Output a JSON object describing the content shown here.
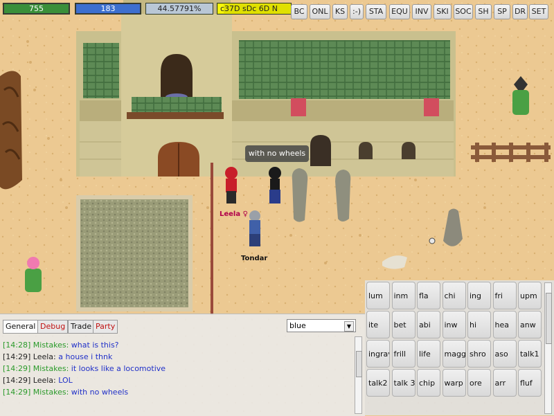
{
  "status": {
    "hp": {
      "value": "755",
      "fraction": 1.0
    },
    "mp": {
      "value": "183",
      "fraction": 1.0
    },
    "xp": {
      "value": "44.57791%",
      "fraction": 0.4458
    },
    "money": {
      "value": "c37D sDc 6D N",
      "fraction": 0.08
    }
  },
  "top_buttons": [
    "BC",
    "ONL",
    "KS",
    ":-)",
    "STA",
    "EQU",
    "INV",
    "SKI",
    "SOC",
    "SH",
    "SP",
    "DR",
    "SET"
  ],
  "scene": {
    "speech_bubble": "with no wheels",
    "players": [
      {
        "name": "Leela ♀",
        "color": "#b0004a"
      },
      {
        "name": "Tondar",
        "color": "#111111"
      }
    ]
  },
  "chat": {
    "tabs": [
      {
        "label": "General",
        "color": "#111111",
        "active": true
      },
      {
        "label": "Debug",
        "color": "#c01010",
        "active": false
      },
      {
        "label": "Trade",
        "color": "#111111",
        "active": false
      },
      {
        "label": "Party",
        "color": "#c01010",
        "active": false
      }
    ],
    "channel": "blue",
    "lines": [
      {
        "time_user": "[14:28] Mistakes:",
        "text": "what is this?",
        "self": true
      },
      {
        "time_user": "[14:29] Leela:",
        "text": "a house i thnk",
        "self": false
      },
      {
        "time_user": "[14:29] Mistakes:",
        "text": "it looks like a locomotive",
        "self": true
      },
      {
        "time_user": "[14:29] Leela:",
        "text": "LOL",
        "self": false
      },
      {
        "time_user": "[14:29] Mistakes:",
        "text": "with no wheels",
        "self": true
      }
    ]
  },
  "shortcuts": [
    [
      "lum",
      "inm",
      "fla",
      "chi",
      "ing",
      "fri",
      "upm"
    ],
    [
      "ite",
      "bet",
      "abi",
      "inw",
      "hi",
      "hea",
      "anw"
    ],
    [
      "ingrav",
      "frill",
      "life",
      "magg",
      "shro",
      "aso",
      "talk1"
    ],
    [
      "talk2",
      "talk 3",
      "chip",
      "warp",
      "ore",
      "arr",
      "fluf"
    ]
  ]
}
